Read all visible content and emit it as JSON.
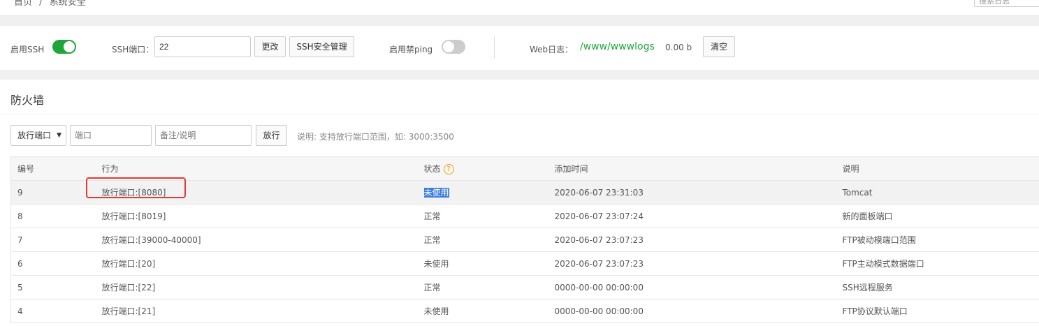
{
  "topbar": {
    "breadcrumb_home": "首页",
    "breadcrumb_sep": "/",
    "breadcrumb_current": "系统安全",
    "search_placeholder": "搜索日志"
  },
  "settings": {
    "ssh_label": "启用SSH",
    "ssh_enabled": true,
    "ssh_port_label": "SSH端口：",
    "ssh_port_value": "22",
    "change_button": "更改",
    "ssh_manage_button": "SSH安全管理",
    "ping_label": "启用禁ping",
    "ping_enabled": false,
    "web_log_label": "Web日志：",
    "web_log_path": "/www/wwwlogs",
    "web_log_size": "0.00 b",
    "clear_button": "清空"
  },
  "firewall": {
    "title": "防火墙",
    "type_select": "放行端口",
    "port_placeholder": "端口",
    "note_placeholder": "备注/说明",
    "allow_button": "放行",
    "hint": "说明: 支持放行端口范围，如: 3000:3500",
    "columns": [
      "编号",
      "行为",
      "状态",
      "添加时间",
      "说明"
    ],
    "status_help_icon": "question-icon",
    "rows": [
      {
        "id": "9",
        "action": "放行端口:[8080]",
        "status": "未使用",
        "time": "2020-06-07 23:31:03",
        "note": "Tomcat"
      },
      {
        "id": "8",
        "action": "放行端口:[8019]",
        "status": "正常",
        "time": "2020-06-07 23:07:24",
        "note": "新的面板端口"
      },
      {
        "id": "7",
        "action": "放行端口:[39000-40000]",
        "status": "正常",
        "time": "2020-06-07 23:07:23",
        "note": "FTP被动模端口范围"
      },
      {
        "id": "6",
        "action": "放行端口:[20]",
        "status": "未使用",
        "time": "2020-06-07 23:07:23",
        "note": "FTP主动模式数据端口"
      },
      {
        "id": "5",
        "action": "放行端口:[22]",
        "status": "正常",
        "time": "0000-00-00 00:00:00",
        "note": "SSH远程服务"
      },
      {
        "id": "4",
        "action": "放行端口:[21]",
        "status": "未使用",
        "time": "0000-00-00 00:00:00",
        "note": "FTP协议默认端口"
      }
    ]
  },
  "colors": {
    "accent_green": "#20a53a",
    "highlight_red": "#e53935",
    "help_orange": "#f0a000"
  }
}
